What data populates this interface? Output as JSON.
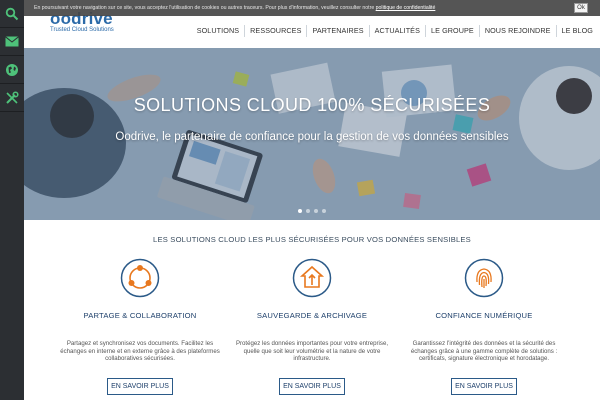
{
  "sidebar": {
    "items": [
      {
        "icon": "search-icon"
      },
      {
        "icon": "mail-icon"
      },
      {
        "icon": "globe-icon"
      },
      {
        "icon": "tools-icon"
      }
    ],
    "accent": "#4ec27a"
  },
  "cookie": {
    "text": "En poursuivant votre navigation sur ce site, vous acceptez l'utilisation de cookies ou autres traceurs. Pour plus d'information, veuillez consulter notre ",
    "link": "politique de confidentialité",
    "ok": "Ok"
  },
  "header": {
    "logo_name": "oodrive",
    "logo_tagline": "Trusted Cloud Solutions",
    "nav": [
      "SOLUTIONS",
      "RESSOURCES",
      "PARTENAIRES",
      "ACTUALITÉS",
      "LE GROUPE",
      "NOUS REJOINDRE",
      "LE BLOG"
    ]
  },
  "hero": {
    "title": "SOLUTIONS CLOUD 100% SÉCURISÉES",
    "subtitle": "Oodrive, le partenaire de confiance pour la gestion de vos données sensibles",
    "slides": 4,
    "active_slide": 1
  },
  "solutions": {
    "heading": "LES SOLUTIONS CLOUD LES PLUS SÉCURISÉES POUR VOS DONNÉES SENSIBLES",
    "items": [
      {
        "icon": "collaboration-icon",
        "title": "PARTAGE & COLLABORATION",
        "text": "Partagez et synchronisez vos documents. Facilitez les échanges en interne et en externe grâce à des plateformes collaboratives sécurisées.",
        "button": "EN SAVOIR PLUS"
      },
      {
        "icon": "backup-icon",
        "title": "SAUVEGARDE & ARCHIVAGE",
        "text": "Protégez les données importantes pour votre entreprise, quelle que soit leur volumétrie et la nature de votre infrastructure.",
        "button": "EN SAVOIR PLUS"
      },
      {
        "icon": "fingerprint-icon",
        "title": "CONFIANCE NUMÉRIQUE",
        "text": "Garantissez l'intégrité des données et la sécurité des échanges grâce à une gamme complète de solutions : certificats, signature électronique et horodatage.",
        "button": "EN SAVOIR PLUS"
      }
    ]
  },
  "colors": {
    "brand_blue": "#2b6aa8",
    "dark_navy": "#1d3f6a",
    "sidebar_bg": "#2c2f33",
    "icon_orange": "#e8781e"
  }
}
